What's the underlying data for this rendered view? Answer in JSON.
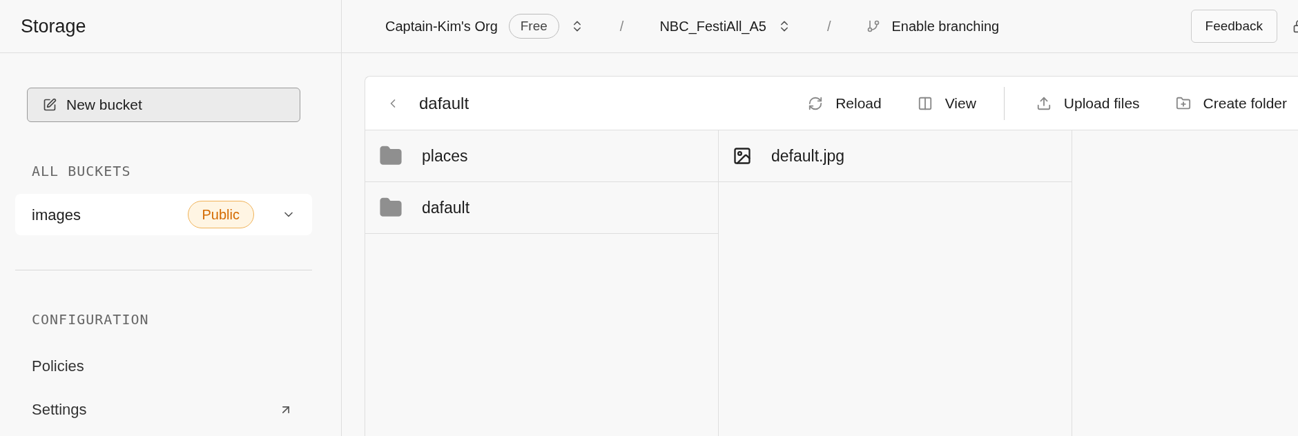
{
  "header": {
    "title": "Storage",
    "org": "Captain-Kim's Org",
    "plan": "Free",
    "separator_1": "/",
    "project": "NBC_FestiAll_A5",
    "separator_2": "/",
    "branching": "Enable branching",
    "feedback": "Feedback"
  },
  "sidebar": {
    "new_bucket": "New bucket",
    "buckets_heading": "ALL BUCKETS",
    "buckets": [
      {
        "name": "images",
        "badge": "Public"
      }
    ],
    "config_heading": "CONFIGURATION",
    "config_items": [
      {
        "label": "Policies",
        "external": false
      },
      {
        "label": "Settings",
        "external": true
      }
    ]
  },
  "explorer": {
    "path": "dafault",
    "actions": [
      {
        "label": "Reload",
        "kind": "reload"
      },
      {
        "label": "View",
        "kind": "view"
      },
      {
        "label": "Upload files",
        "kind": "upload"
      },
      {
        "label": "Create folder",
        "kind": "folder"
      }
    ],
    "columns": [
      {
        "items": [
          {
            "name": "places",
            "kind": "folder"
          },
          {
            "name": "dafault",
            "kind": "folder"
          }
        ]
      },
      {
        "items": [
          {
            "name": "default.jpg",
            "kind": "image"
          }
        ]
      }
    ]
  }
}
